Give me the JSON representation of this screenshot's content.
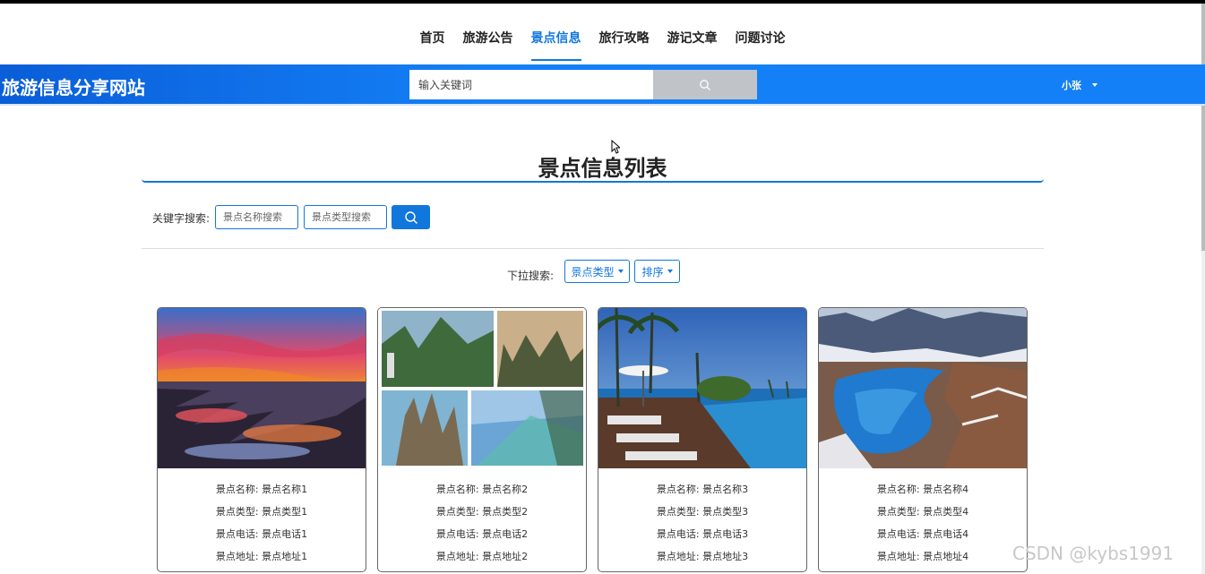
{
  "nav": {
    "items": [
      {
        "label": "首页",
        "active": false
      },
      {
        "label": "旅游公告",
        "active": false
      },
      {
        "label": "景点信息",
        "active": true
      },
      {
        "label": "旅行攻略",
        "active": false
      },
      {
        "label": "游记文章",
        "active": false
      },
      {
        "label": "问题讨论",
        "active": false
      }
    ]
  },
  "header": {
    "site_title": "旅游信息分享网站",
    "search_placeholder": "输入关键词",
    "user_name": "小张"
  },
  "main": {
    "page_title": "景点信息列表",
    "keyword_label": "关键字搜索:",
    "name_search_placeholder": "景点名称搜索",
    "type_search_placeholder": "景点类型搜索",
    "dropdown_label": "下拉搜索:",
    "type_dropdown": "景点类型",
    "sort_dropdown": "排序"
  },
  "cards": [
    {
      "name_label": "景点名称:",
      "name": "景点名称1",
      "type_label": "景点类型:",
      "type": "景点类型1",
      "phone_label": "景点电话:",
      "phone": "景点电话1",
      "addr_label": "景点地址:",
      "addr": "景点地址1"
    },
    {
      "name_label": "景点名称:",
      "name": "景点名称2",
      "type_label": "景点类型:",
      "type": "景点类型2",
      "phone_label": "景点电话:",
      "phone": "景点电话2",
      "addr_label": "景点地址:",
      "addr": "景点地址2"
    },
    {
      "name_label": "景点名称:",
      "name": "景点名称3",
      "type_label": "景点类型:",
      "type": "景点类型3",
      "phone_label": "景点电话:",
      "phone": "景点电话3",
      "addr_label": "景点地址:",
      "addr": "景点地址3"
    },
    {
      "name_label": "景点名称:",
      "name": "景点名称4",
      "type_label": "景点类型:",
      "type": "景点类型4",
      "phone_label": "景点电话:",
      "phone": "景点电话4",
      "addr_label": "景点地址:",
      "addr": "景点地址4"
    }
  ],
  "watermark": "CSDN @kybs1991",
  "colors": {
    "accent": "#1177dd",
    "banner": "#1480f7",
    "search_button": "#c0c4c8"
  }
}
